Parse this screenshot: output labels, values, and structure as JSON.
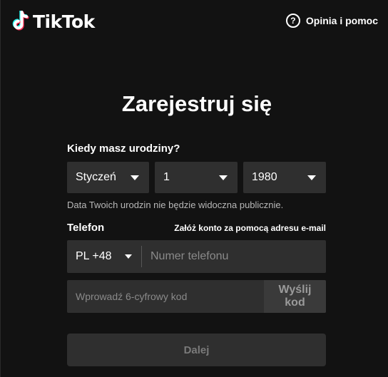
{
  "brand": {
    "name": "TikTok",
    "logo_icon": "tiktok-note-icon",
    "colors": {
      "cyan": "#25F4EE",
      "red": "#FE2C55",
      "white": "#FFFFFF"
    }
  },
  "header": {
    "help_icon": "question-circle-icon",
    "help_label": "Opinia i pomoc"
  },
  "title": "Zarejestruj się",
  "birthday": {
    "label": "Kiedy masz urodziny?",
    "month": "Styczeń",
    "day": "1",
    "year": "1980",
    "hint": "Data Twoich urodzin nie będzie widoczna publicznie."
  },
  "phone": {
    "label": "Telefon",
    "email_link": "Załóż konto za pomocą adresu e-mail",
    "country_code": "PL +48",
    "placeholder": "Numer telefonu"
  },
  "code": {
    "placeholder": "Wprowadź 6-cyfrowy kod",
    "send_label": "Wyślij kod"
  },
  "next_label": "Dalej",
  "theme": {
    "background": "#121212",
    "field": "#2F2F2F",
    "muted_text": "#B8B8B8"
  }
}
